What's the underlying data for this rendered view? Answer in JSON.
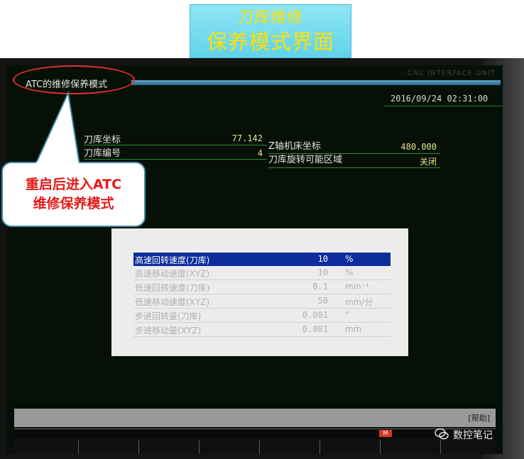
{
  "slide": {
    "title_line1": "刀库维修",
    "title_line2": "保养模式界面"
  },
  "screen": {
    "brand": "CNC INTERFACE UNIT",
    "header_title": "ATC的维修保养模式",
    "datetime": "2016/09/24 02:31:00",
    "info": {
      "magazine_coord_label": "刀库坐标",
      "magazine_coord_value": "77.142",
      "magazine_no_label": "刀库编号",
      "magazine_no_value": "4",
      "z_axis_label": "Z轴机床坐标",
      "z_axis_value": "480.000",
      "rotate_zone_label": "刀库旋转可能区域",
      "rotate_zone_value": "关闭"
    },
    "settings": [
      {
        "label": "高速回转速度(刀库)",
        "value": "10",
        "unit": "%"
      },
      {
        "label": "高速移动速度(XYZ)",
        "value": "10",
        "unit": "%"
      },
      {
        "label": "低速回转速度(刀库)",
        "value": "0.1",
        "unit": "min⁻¹"
      },
      {
        "label": "低速移动速度(XYZ)",
        "value": "50",
        "unit": "mm/分"
      },
      {
        "label": "步进回转量(刀库)",
        "value": "0.001",
        "unit": "°"
      },
      {
        "label": "步进移动量(XYZ)",
        "value": "0.001",
        "unit": "mm"
      }
    ],
    "help_label": "[帮助]",
    "status_icon": "MEM-icon"
  },
  "callout": {
    "line1": "重启后进入ATC",
    "line2": "维修保养模式"
  },
  "watermark": "数控笔记",
  "colors": {
    "title_text": "#ffe100",
    "callout_text": "#e61919",
    "selected_row": "#0d2d9a",
    "header_bar": "#4a8db5"
  }
}
